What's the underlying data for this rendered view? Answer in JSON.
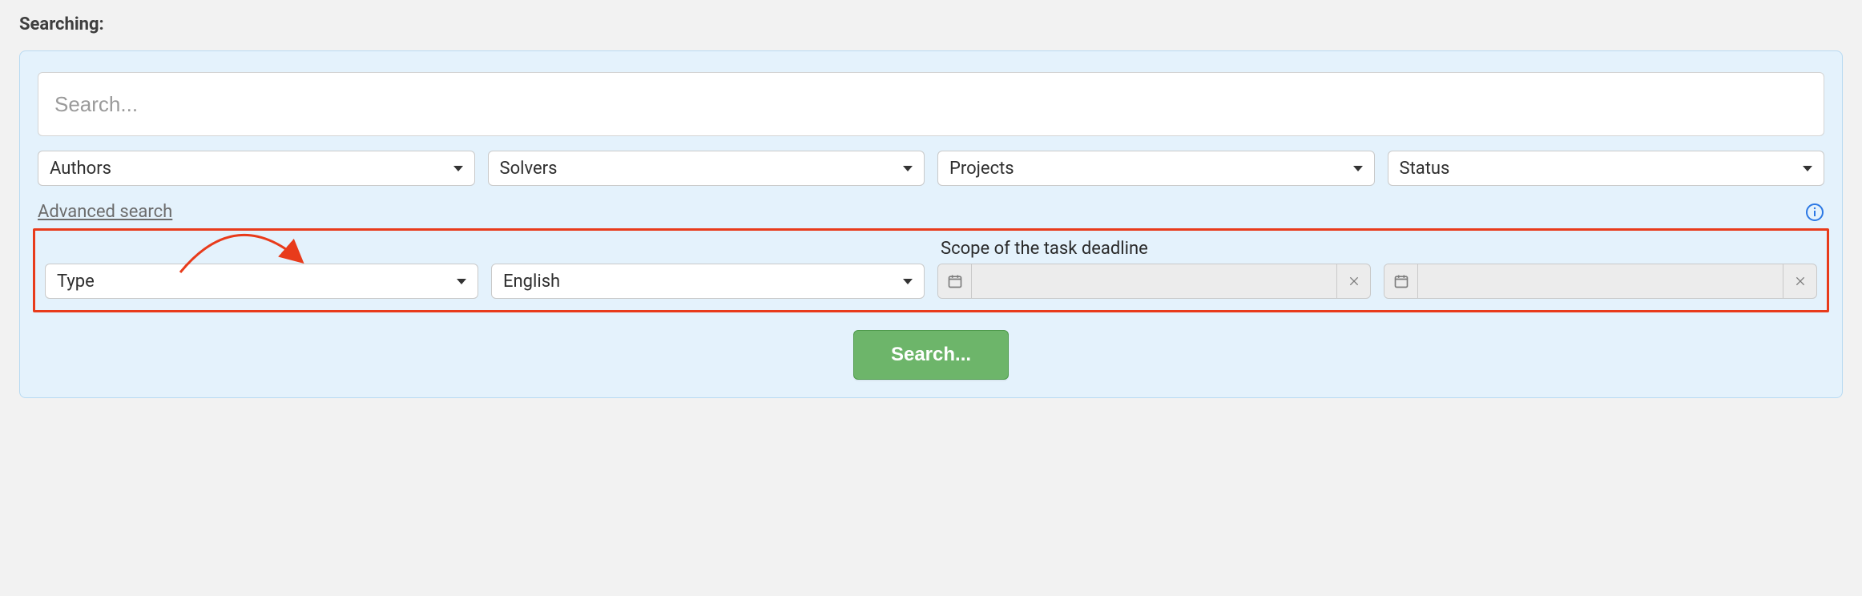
{
  "heading": "Searching:",
  "search": {
    "placeholder": "Search...",
    "value": ""
  },
  "filters": {
    "authors": "Authors",
    "solvers": "Solvers",
    "projects": "Projects",
    "status": "Status"
  },
  "advanced_link": "Advanced search",
  "advanced": {
    "type": "Type",
    "language": "English",
    "scope_label": "Scope of the task deadline",
    "date_from": "",
    "date_to": ""
  },
  "search_button": "Search..."
}
